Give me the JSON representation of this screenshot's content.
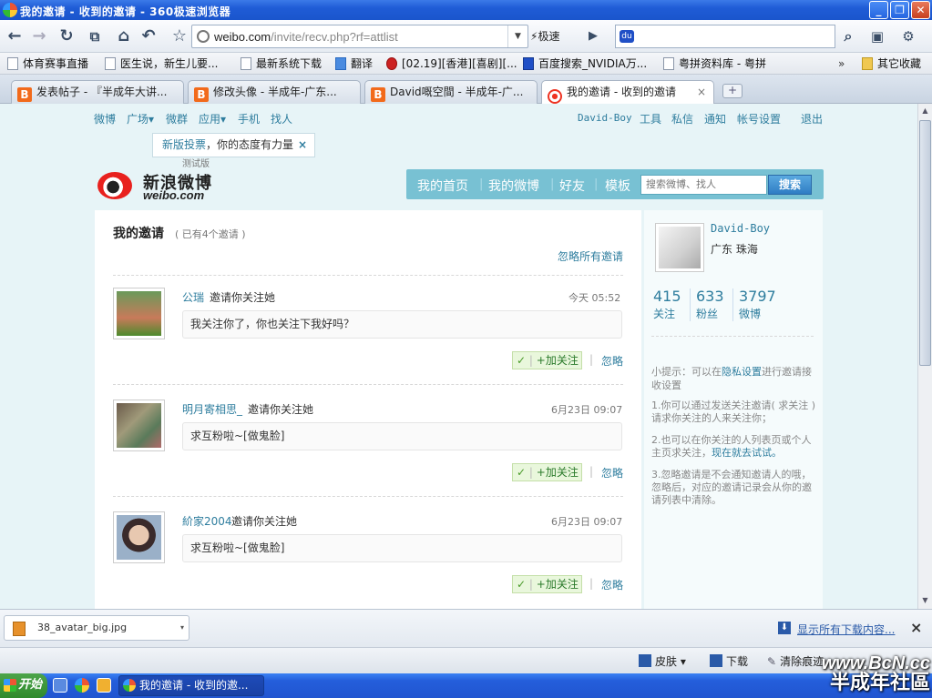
{
  "window": {
    "title": "我的邀请 - 收到的邀请 - 360极速浏览器"
  },
  "nav": {
    "url_host": "weibo.com",
    "url_path": "/invite/recv.php?rf=attlist",
    "speed_label": "极速",
    "search_value": ""
  },
  "bookmarks": [
    "体育赛事直播",
    "医生说，新生儿要...",
    "最新系统下载",
    "翻译",
    "[02.19][香港][喜剧][...",
    "百度搜索_NVIDIA万...",
    "粤拼资料库 - 粤拼",
    "其它收藏"
  ],
  "tabs": [
    {
      "label": "发表帖子 - 『半成年大讲..."
    },
    {
      "label": "修改头像 - 半成年-广东..."
    },
    {
      "label": "David嘅空間 - 半成年-广..."
    },
    {
      "label": "我的邀请 - 收到的邀请"
    }
  ],
  "weibo": {
    "top_left": [
      "微博",
      "广场▾",
      "微群",
      "应用▾",
      "手机",
      "找人"
    ],
    "top_right": [
      "David-Boy",
      "工具",
      "私信",
      "通知",
      "帐号设置",
      "退出"
    ],
    "tooltip_hl": "新版投票",
    "tooltip_text": "，你的态度有力量",
    "tooltip_close": "×",
    "beta": "测试版",
    "logo_cn": "新浪微博",
    "logo_en": "weibo.com",
    "main_nav": [
      "我的首页",
      "我的微博",
      "好友",
      "模板"
    ],
    "search_placeholder": "搜索微博、找人",
    "search_btn": "搜索"
  },
  "invites": {
    "title": "我的邀请",
    "count_note": "( 已有4个邀请 )",
    "ignore_all": "忽略所有邀请",
    "follow_label": "+加关注",
    "follow_check": "✓",
    "ignore_label": "忽略",
    "items": [
      {
        "user": "公瑞",
        "action": "邀请你关注她",
        "time": "今天 05:52",
        "message": "我关注你了，你也关注下我好吗？"
      },
      {
        "user": "明月寄相思_",
        "action": "邀请你关注她",
        "time": "6月23日 09:07",
        "message": "求互粉啦~[做鬼脸]"
      },
      {
        "user": "紒家2004",
        "action": "邀请你关注她",
        "time": "6月23日 09:07",
        "message": "求互粉啦~[做鬼脸]"
      }
    ]
  },
  "profile": {
    "name": "David-Boy",
    "location": "广东  珠海",
    "stats": [
      {
        "value": "415",
        "label": "关注"
      },
      {
        "value": "633",
        "label": "粉丝"
      },
      {
        "value": "3797",
        "label": "微博"
      }
    ],
    "tip_prefix": "小提示：可以在",
    "tip_link": "隐私设置",
    "tip_suffix": "进行邀请接收设置",
    "tip1": "1.你可以通过发送关注邀请( 求关注 )请求你关注的人来关注你；",
    "tip2_prefix": "2.也可以在你关注的人列表页或个人主页求关注，",
    "tip2_link": "现在就去试试。",
    "tip3": "3.忽略邀请是不会通知邀请人的哦，忽略后，对应的邀请记录会从你的邀请列表中清除。"
  },
  "downloads": {
    "file": "38_avatar_big.jpg",
    "show_all": "显示所有下载内容..."
  },
  "status": {
    "skin": "皮肤 ▾",
    "download": "下载",
    "clear": "清除痕迹"
  },
  "taskbar": {
    "start": "开始",
    "item": "我的邀请 - 收到的邀..."
  },
  "watermark": {
    "line1": "www.BcN.cc",
    "line2": "半成年社區"
  },
  "colors": {
    "accent": "#2e7d9e",
    "page_bg": "#e7f4f7",
    "nav_bar": "#78c1d3",
    "follow_bg": "#e9f7dc"
  }
}
